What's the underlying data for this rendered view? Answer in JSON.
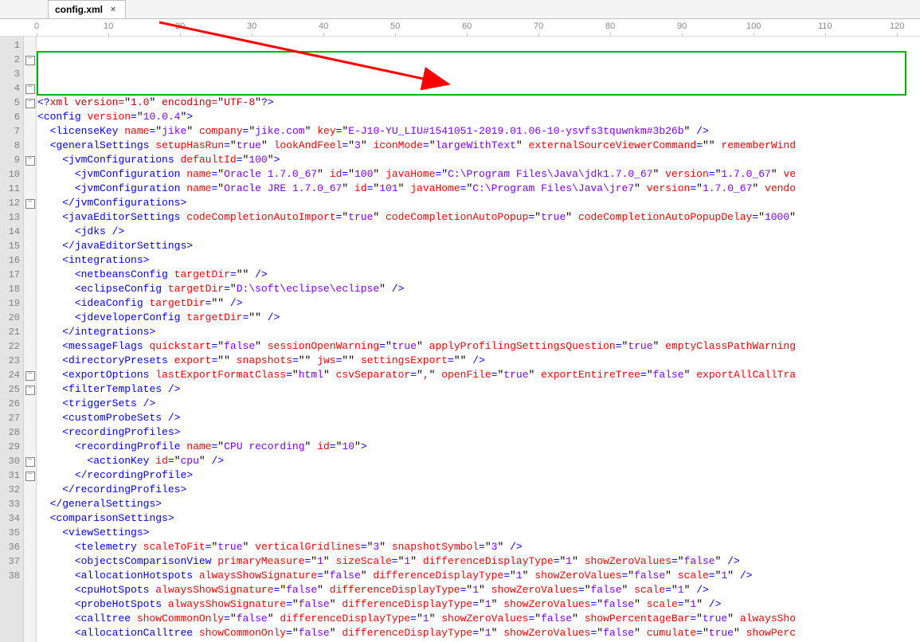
{
  "tab": {
    "title": "config.xml",
    "close": "×"
  },
  "ruler_labels": [
    "0",
    "10",
    "20",
    "30",
    "40",
    "50",
    "60",
    "70",
    "80",
    "90",
    "100",
    "110",
    "120"
  ],
  "lines": {
    "l1": {
      "num": "1",
      "html": "<span class='pu'>&lt;?</span><span class='xd'>xml version=</span><span class='q'>\"</span><span class='xd'>1.0</span><span class='q'>\"</span> <span class='xd'>encoding=</span><span class='q'>\"</span><span class='xd'>UTF-8</span><span class='q'>\"</span><span class='pu'>?&gt;</span>"
    },
    "l2": {
      "num": "2",
      "html": "<span class='pu'>&lt;</span><span class='tg'>config</span> <span class='at'>version</span><span class='pu'>=</span><span class='q'>\"</span><span class='av'>10.0.4</span><span class='q'>\"</span><span class='pu'>&gt;</span>"
    },
    "l3": {
      "num": "3",
      "html": "  <span class='pu'>&lt;</span><span class='tg'>licenseKey</span> <span class='at'>name</span><span class='pu'>=</span><span class='q'>\"</span><span class='av'>jike</span><span class='q'>\"</span> <span class='at'>company</span><span class='pu'>=</span><span class='q'>\"</span><span class='av'>jike.com</span><span class='q'>\"</span> <span class='at'>key</span><span class='pu'>=</span><span class='q'>\"</span><span class='av'>E-J10-YU_LIU#1541051-2019.01.06-10-ysvfs3tquwnkm#3b26b</span><span class='q'>\"</span> <span class='pu'>/&gt;</span>"
    },
    "l4": {
      "num": "4",
      "html": "  <span class='pu'>&lt;</span><span class='tg'>generalSettings</span> <span class='at'>setupHasRun</span><span class='pu'>=</span><span class='q'>\"</span><span class='av'>true</span><span class='q'>\"</span> <span class='at'>lookAndFeel</span><span class='pu'>=</span><span class='q'>\"</span><span class='av'>3</span><span class='q'>\"</span> <span class='at'>iconMode</span><span class='pu'>=</span><span class='q'>\"</span><span class='av'>largeWithText</span><span class='q'>\"</span> <span class='at'>externalSourceViewerCommand</span><span class='pu'>=</span><span class='q'>\"\"</span> <span class='at'>rememberWind</span>"
    },
    "l5": {
      "num": "5",
      "html": "    <span class='pu'>&lt;</span><span class='tg'>jvmConfigurations</span> <span class='at'>defaultId</span><span class='pu'>=</span><span class='q'>\"</span><span class='av'>100</span><span class='q'>\"</span><span class='pu'>&gt;</span>"
    },
    "l6": {
      "num": "6",
      "html": "      <span class='pu'>&lt;</span><span class='tg'>jvmConfiguration</span> <span class='at'>name</span><span class='pu'>=</span><span class='q'>\"</span><span class='av'>Oracle 1.7.0_67</span><span class='q'>\"</span> <span class='at'>id</span><span class='pu'>=</span><span class='q'>\"</span><span class='av'>100</span><span class='q'>\"</span> <span class='at'>javaHome</span><span class='pu'>=</span><span class='q'>\"</span><span class='av'>C:\\Program Files\\Java\\jdk1.7.0_67</span><span class='q'>\"</span> <span class='at'>version</span><span class='pu'>=</span><span class='q'>\"</span><span class='av'>1.7.0_67</span><span class='q'>\"</span> <span class='at'>ve</span>"
    },
    "l7": {
      "num": "7",
      "html": "      <span class='pu'>&lt;</span><span class='tg'>jvmConfiguration</span> <span class='at'>name</span><span class='pu'>=</span><span class='q'>\"</span><span class='av'>Oracle JRE 1.7.0_67</span><span class='q'>\"</span> <span class='at'>id</span><span class='pu'>=</span><span class='q'>\"</span><span class='av'>101</span><span class='q'>\"</span> <span class='at'>javaHome</span><span class='pu'>=</span><span class='q'>\"</span><span class='av'>C:\\Program Files\\Java\\jre7</span><span class='q'>\"</span> <span class='at'>version</span><span class='pu'>=</span><span class='q'>\"</span><span class='av'>1.7.0_67</span><span class='q'>\"</span> <span class='at'>vendo</span>"
    },
    "l8": {
      "num": "8",
      "html": "    <span class='pu'>&lt;/</span><span class='tg'>jvmConfigurations</span><span class='pu'>&gt;</span>"
    },
    "l9": {
      "num": "9",
      "html": "    <span class='pu'>&lt;</span><span class='tg'>javaEditorSettings</span> <span class='at'>codeCompletionAutoImport</span><span class='pu'>=</span><span class='q'>\"</span><span class='av'>true</span><span class='q'>\"</span> <span class='at'>codeCompletionAutoPopup</span><span class='pu'>=</span><span class='q'>\"</span><span class='av'>true</span><span class='q'>\"</span> <span class='at'>codeCompletionAutoPopupDelay</span><span class='pu'>=</span><span class='q'>\"</span><span class='av'>1000</span><span class='q'>\"</span>"
    },
    "l10": {
      "num": "10",
      "html": "      <span class='pu'>&lt;</span><span class='tg'>jdks</span> <span class='pu'>/&gt;</span>"
    },
    "l11": {
      "num": "11",
      "html": "    <span class='pu'>&lt;/</span><span class='tg'>javaEditorSettings</span><span class='pu'>&gt;</span>"
    },
    "l12": {
      "num": "12",
      "html": "    <span class='pu'>&lt;</span><span class='tg'>integrations</span><span class='pu'>&gt;</span>"
    },
    "l13": {
      "num": "13",
      "html": "      <span class='pu'>&lt;</span><span class='tg'>netbeansConfig</span> <span class='at'>targetDir</span><span class='pu'>=</span><span class='q'>\"\"</span> <span class='pu'>/&gt;</span>"
    },
    "l14": {
      "num": "14",
      "html": "      <span class='pu'>&lt;</span><span class='tg'>eclipseConfig</span> <span class='at'>targetDir</span><span class='pu'>=</span><span class='q'>\"</span><span class='av'>D:\\soft\\eclipse\\eclipse</span><span class='q'>\"</span> <span class='pu'>/&gt;</span>"
    },
    "l15": {
      "num": "15",
      "html": "      <span class='pu'>&lt;</span><span class='tg'>ideaConfig</span> <span class='at'>targetDir</span><span class='pu'>=</span><span class='q'>\"\"</span> <span class='pu'>/&gt;</span>"
    },
    "l16": {
      "num": "16",
      "html": "      <span class='pu'>&lt;</span><span class='tg'>jdeveloperConfig</span> <span class='at'>targetDir</span><span class='pu'>=</span><span class='q'>\"\"</span> <span class='pu'>/&gt;</span>"
    },
    "l17": {
      "num": "17",
      "html": "    <span class='pu'>&lt;/</span><span class='tg'>integrations</span><span class='pu'>&gt;</span>"
    },
    "l18": {
      "num": "18",
      "html": "    <span class='pu'>&lt;</span><span class='tg'>messageFlags</span> <span class='at'>quickstart</span><span class='pu'>=</span><span class='q'>\"</span><span class='av'>false</span><span class='q'>\"</span> <span class='at'>sessionOpenWarning</span><span class='pu'>=</span><span class='q'>\"</span><span class='av'>true</span><span class='q'>\"</span> <span class='at'>applyProfilingSettingsQuestion</span><span class='pu'>=</span><span class='q'>\"</span><span class='av'>true</span><span class='q'>\"</span> <span class='at'>emptyClassPathWarning</span>"
    },
    "l19": {
      "num": "19",
      "html": "    <span class='pu'>&lt;</span><span class='tg'>directoryPresets</span> <span class='at'>export</span><span class='pu'>=</span><span class='q'>\"\"</span> <span class='at'>snapshots</span><span class='pu'>=</span><span class='q'>\"\"</span> <span class='at'>jws</span><span class='pu'>=</span><span class='q'>\"\"</span> <span class='at'>settingsExport</span><span class='pu'>=</span><span class='q'>\"\"</span> <span class='pu'>/&gt;</span>"
    },
    "l20": {
      "num": "20",
      "html": "    <span class='pu'>&lt;</span><span class='tg'>exportOptions</span> <span class='at'>lastExportFormatClass</span><span class='pu'>=</span><span class='q'>\"</span><span class='av'>html</span><span class='q'>\"</span> <span class='at'>csvSeparator</span><span class='pu'>=</span><span class='q'>\"</span><span class='av'>,</span><span class='q'>\"</span> <span class='at'>openFile</span><span class='pu'>=</span><span class='q'>\"</span><span class='av'>true</span><span class='q'>\"</span> <span class='at'>exportEntireTree</span><span class='pu'>=</span><span class='q'>\"</span><span class='av'>false</span><span class='q'>\"</span> <span class='at'>exportAllCallTra</span>"
    },
    "l21": {
      "num": "21",
      "html": "    <span class='pu'>&lt;</span><span class='tg'>filterTemplates</span> <span class='pu'>/&gt;</span>"
    },
    "l22": {
      "num": "22",
      "html": "    <span class='pu'>&lt;</span><span class='tg'>triggerSets</span> <span class='pu'>/&gt;</span>"
    },
    "l23": {
      "num": "23",
      "html": "    <span class='pu'>&lt;</span><span class='tg'>customProbeSets</span> <span class='pu'>/&gt;</span>"
    },
    "l24": {
      "num": "24",
      "html": "    <span class='pu'>&lt;</span><span class='tg'>recordingProfiles</span><span class='pu'>&gt;</span>"
    },
    "l25": {
      "num": "25",
      "html": "      <span class='pu'>&lt;</span><span class='tg'>recordingProfile</span> <span class='at'>name</span><span class='pu'>=</span><span class='q'>\"</span><span class='av'>CPU recording</span><span class='q'>\"</span> <span class='at'>id</span><span class='pu'>=</span><span class='q'>\"</span><span class='av'>10</span><span class='q'>\"</span><span class='pu'>&gt;</span>"
    },
    "l26": {
      "num": "26",
      "html": "        <span class='pu'>&lt;</span><span class='tg'>actionKey</span> <span class='at'>id</span><span class='pu'>=</span><span class='q'>\"</span><span class='av'>cpu</span><span class='q'>\"</span> <span class='pu'>/&gt;</span>"
    },
    "l27": {
      "num": "27",
      "html": "      <span class='pu'>&lt;/</span><span class='tg'>recordingProfile</span><span class='pu'>&gt;</span>"
    },
    "l28": {
      "num": "28",
      "html": "    <span class='pu'>&lt;/</span><span class='tg'>recordingProfiles</span><span class='pu'>&gt;</span>"
    },
    "l29": {
      "num": "29",
      "html": "  <span class='pu'>&lt;/</span><span class='tg'>generalSettings</span><span class='pu'>&gt;</span>"
    },
    "l30": {
      "num": "30",
      "html": "  <span class='pu'>&lt;</span><span class='tg'>comparisonSettings</span><span class='pu'>&gt;</span>"
    },
    "l31": {
      "num": "31",
      "html": "    <span class='pu'>&lt;</span><span class='tg'>viewSettings</span><span class='pu'>&gt;</span>"
    },
    "l32": {
      "num": "32",
      "html": "      <span class='pu'>&lt;</span><span class='tg'>telemetry</span> <span class='at'>scaleToFit</span><span class='pu'>=</span><span class='q'>\"</span><span class='av'>true</span><span class='q'>\"</span> <span class='at'>verticalGridlines</span><span class='pu'>=</span><span class='q'>\"</span><span class='av'>3</span><span class='q'>\"</span> <span class='at'>snapshotSymbol</span><span class='pu'>=</span><span class='q'>\"</span><span class='av'>3</span><span class='q'>\"</span> <span class='pu'>/&gt;</span>"
    },
    "l33": {
      "num": "33",
      "html": "      <span class='pu'>&lt;</span><span class='tg'>objectsComparisonView</span> <span class='at'>primaryMeasure</span><span class='pu'>=</span><span class='q'>\"</span><span class='av'>1</span><span class='q'>\"</span> <span class='at'>sizeScale</span><span class='pu'>=</span><span class='q'>\"</span><span class='av'>1</span><span class='q'>\"</span> <span class='at'>differenceDisplayType</span><span class='pu'>=</span><span class='q'>\"</span><span class='av'>1</span><span class='q'>\"</span> <span class='at'>showZeroValues</span><span class='pu'>=</span><span class='q'>\"</span><span class='av'>false</span><span class='q'>\"</span> <span class='pu'>/&gt;</span>"
    },
    "l34": {
      "num": "34",
      "html": "      <span class='pu'>&lt;</span><span class='tg'>allocationHotspots</span> <span class='at'>alwaysShowSignature</span><span class='pu'>=</span><span class='q'>\"</span><span class='av'>false</span><span class='q'>\"</span> <span class='at'>differenceDisplayType</span><span class='pu'>=</span><span class='q'>\"</span><span class='av'>1</span><span class='q'>\"</span> <span class='at'>showZeroValues</span><span class='pu'>=</span><span class='q'>\"</span><span class='av'>false</span><span class='q'>\"</span> <span class='at'>scale</span><span class='pu'>=</span><span class='q'>\"</span><span class='av'>1</span><span class='q'>\"</span> <span class='pu'>/&gt;</span>"
    },
    "l35": {
      "num": "35",
      "html": "      <span class='pu'>&lt;</span><span class='tg'>cpuHotSpots</span> <span class='at'>alwaysShowSignature</span><span class='pu'>=</span><span class='q'>\"</span><span class='av'>false</span><span class='q'>\"</span> <span class='at'>differenceDisplayType</span><span class='pu'>=</span><span class='q'>\"</span><span class='av'>1</span><span class='q'>\"</span> <span class='at'>showZeroValues</span><span class='pu'>=</span><span class='q'>\"</span><span class='av'>false</span><span class='q'>\"</span> <span class='at'>scale</span><span class='pu'>=</span><span class='q'>\"</span><span class='av'>1</span><span class='q'>\"</span> <span class='pu'>/&gt;</span>"
    },
    "l36": {
      "num": "36",
      "html": "      <span class='pu'>&lt;</span><span class='tg'>probeHotSpots</span> <span class='at'>alwaysShowSignature</span><span class='pu'>=</span><span class='q'>\"</span><span class='av'>false</span><span class='q'>\"</span> <span class='at'>differenceDisplayType</span><span class='pu'>=</span><span class='q'>\"</span><span class='av'>1</span><span class='q'>\"</span> <span class='at'>showZeroValues</span><span class='pu'>=</span><span class='q'>\"</span><span class='av'>false</span><span class='q'>\"</span> <span class='at'>scale</span><span class='pu'>=</span><span class='q'>\"</span><span class='av'>1</span><span class='q'>\"</span> <span class='pu'>/&gt;</span>"
    },
    "l37": {
      "num": "37",
      "html": "      <span class='pu'>&lt;</span><span class='tg'>calltree</span> <span class='at'>showCommonOnly</span><span class='pu'>=</span><span class='q'>\"</span><span class='av'>false</span><span class='q'>\"</span> <span class='at'>differenceDisplayType</span><span class='pu'>=</span><span class='q'>\"</span><span class='av'>1</span><span class='q'>\"</span> <span class='at'>showZeroValues</span><span class='pu'>=</span><span class='q'>\"</span><span class='av'>false</span><span class='q'>\"</span> <span class='at'>showPercentageBar</span><span class='pu'>=</span><span class='q'>\"</span><span class='av'>true</span><span class='q'>\"</span> <span class='at'>alwaysSho</span>"
    },
    "l38": {
      "num": "38",
      "html": "      <span class='pu'>&lt;</span><span class='tg'>allocationCalltree</span> <span class='at'>showCommonOnly</span><span class='pu'>=</span><span class='q'>\"</span><span class='av'>false</span><span class='q'>\"</span> <span class='at'>differenceDisplayType</span><span class='pu'>=</span><span class='q'>\"</span><span class='av'>1</span><span class='q'>\"</span> <span class='at'>showZeroValues</span><span class='pu'>=</span><span class='q'>\"</span><span class='av'>false</span><span class='q'>\"</span> <span class='at'>cumulate</span><span class='pu'>=</span><span class='q'>\"</span><span class='av'>true</span><span class='q'>\"</span> <span class='at'>showPerc</span>"
    }
  },
  "fold_rows": [
    2,
    4,
    5,
    9,
    12,
    24,
    25,
    30,
    31
  ],
  "watermark": ""
}
